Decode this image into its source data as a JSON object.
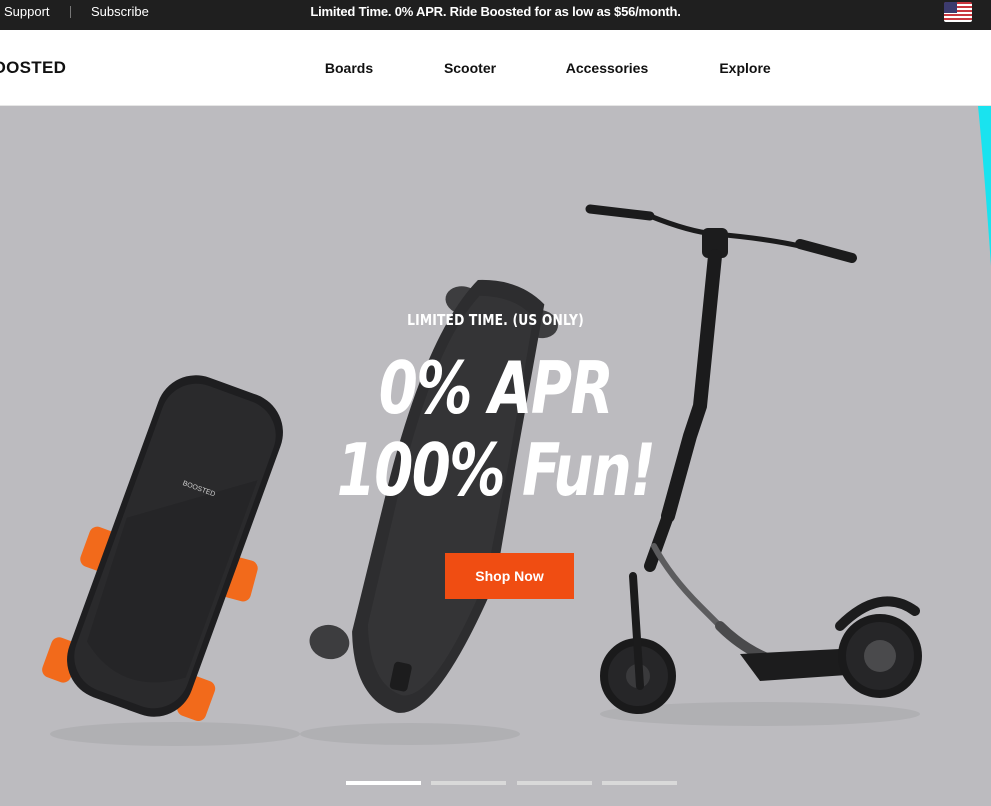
{
  "topbar": {
    "support_label": "Support",
    "subscribe_label": "Subscribe",
    "promo_text": "Limited Time. 0% APR. Ride Boosted for as low as $56/month.",
    "flag_icon": "us-flag-icon"
  },
  "header": {
    "logo_text": "BOOSTED",
    "nav": {
      "boards": "Boards",
      "scooter": "Scooter",
      "accessories": "Accessories",
      "explore": "Explore"
    }
  },
  "hero": {
    "eyebrow": "LIMITED TIME. (US ONLY)",
    "headline_line1": "0% APR",
    "headline_line2": "100% Fun!",
    "cta_label": "Shop Now",
    "slides": {
      "count": 4,
      "active": 1
    }
  },
  "colors": {
    "topbar_bg": "#1f1f1f",
    "hero_bg": "#bcbbbf",
    "cta": "#f04d12",
    "wheel_orange": "#f26a1b"
  }
}
